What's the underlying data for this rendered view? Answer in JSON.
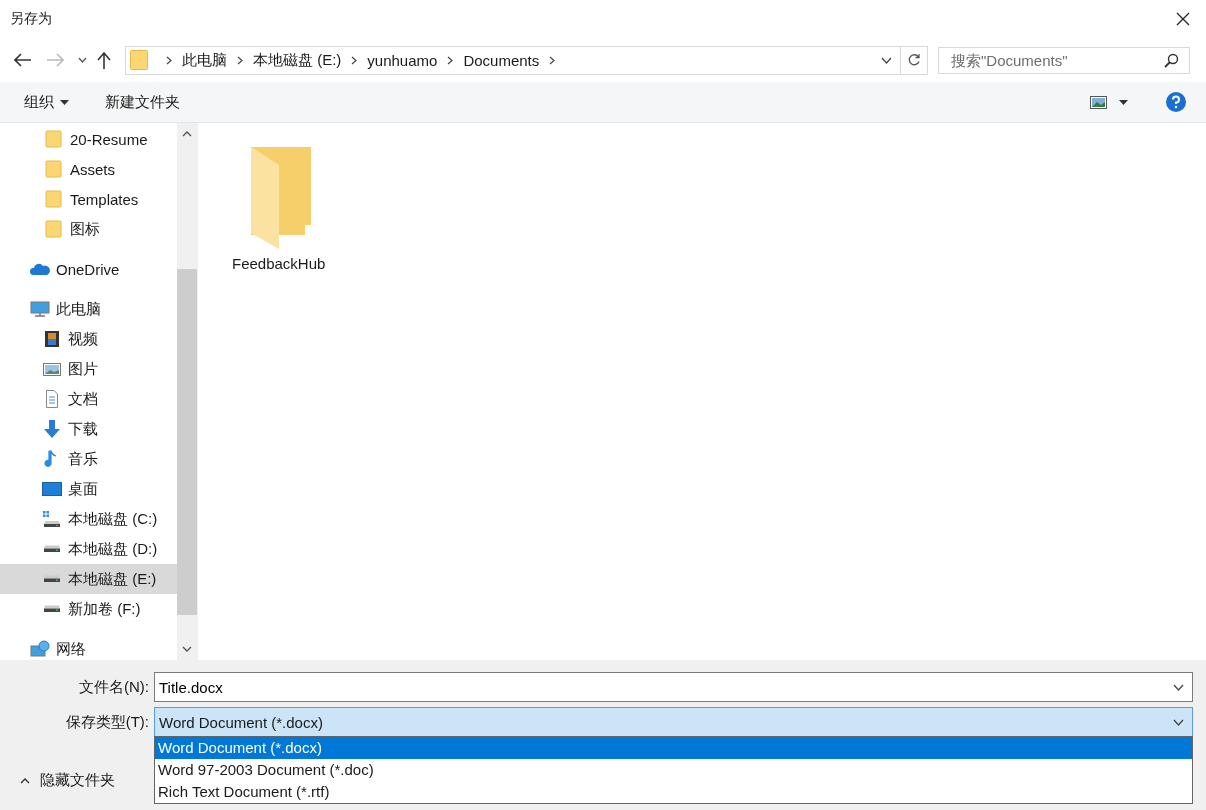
{
  "window": {
    "title": "另存为"
  },
  "address_bar": {
    "path": [
      "此电脑",
      "本地磁盘 (E:)",
      "yunhuamo",
      "Documents"
    ]
  },
  "search": {
    "placeholder": "搜索\"Documents\""
  },
  "toolbar": {
    "organize": "组织",
    "new_folder": "新建文件夹"
  },
  "sidebar": {
    "pinned": [
      {
        "label": "20-Resume",
        "kind": "folder",
        "selected": false
      },
      {
        "label": "Assets",
        "kind": "folder",
        "selected": false
      },
      {
        "label": "Templates",
        "kind": "folder",
        "selected": false
      },
      {
        "label": "图标",
        "kind": "folder",
        "selected": false
      }
    ],
    "items": [
      {
        "label": "OneDrive",
        "kind": "cloud",
        "selected": false
      },
      {
        "label": "此电脑",
        "kind": "computer",
        "selected": false,
        "children": [
          {
            "label": "视频",
            "kind": "video",
            "selected": false
          },
          {
            "label": "图片",
            "kind": "pictures",
            "selected": false
          },
          {
            "label": "文档",
            "kind": "documents",
            "selected": false
          },
          {
            "label": "下载",
            "kind": "download",
            "selected": false
          },
          {
            "label": "音乐",
            "kind": "music",
            "selected": false
          },
          {
            "label": "桌面",
            "kind": "desktop",
            "selected": false
          },
          {
            "label": "本地磁盘 (C:)",
            "kind": "system-drive",
            "selected": false
          },
          {
            "label": "本地磁盘 (D:)",
            "kind": "drive",
            "selected": false
          },
          {
            "label": "本地磁盘 (E:)",
            "kind": "drive",
            "selected": true
          },
          {
            "label": "新加卷 (F:)",
            "kind": "drive",
            "selected": false
          }
        ]
      },
      {
        "label": "网络",
        "kind": "network",
        "selected": false
      }
    ]
  },
  "files": [
    {
      "name": "FeedbackHub",
      "kind": "folder"
    }
  ],
  "filename": {
    "label": "文件名(N):",
    "value": "Title.docx"
  },
  "filetype": {
    "label": "保存类型(T):",
    "value": "Word Document (*.docx)",
    "expanded": true,
    "options": [
      {
        "label": "Word Document (*.docx)",
        "selected": true
      },
      {
        "label": "Word 97-2003 Document (*.doc)",
        "selected": false
      },
      {
        "label": "Rich Text Document (*.rtf)",
        "selected": false
      }
    ]
  },
  "hide_folders": "隐藏文件夹"
}
